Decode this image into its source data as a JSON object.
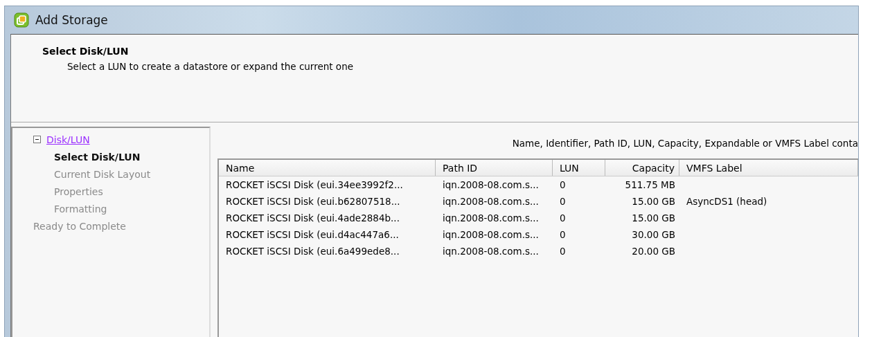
{
  "window": {
    "title": "Add Storage"
  },
  "header": {
    "title": "Select Disk/LUN",
    "subtitle": "Select a LUN to create a datastore or expand the current one"
  },
  "steps": [
    {
      "label": "Disk/LUN",
      "kind": "link",
      "selected": false,
      "expanded": true,
      "children": [
        {
          "label": "Select Disk/LUN",
          "selected": true
        },
        {
          "label": "Current Disk Layout",
          "selected": false
        },
        {
          "label": "Properties",
          "selected": false
        },
        {
          "label": "Formatting",
          "selected": false
        }
      ]
    },
    {
      "label": "Ready to Complete",
      "kind": "step",
      "selected": false
    }
  ],
  "filter_hint": "Name, Identifier, Path ID, LUN, Capacity, Expandable or VMFS Label conta",
  "table": {
    "columns": [
      "Name",
      "Path ID",
      "LUN",
      "Capacity",
      "VMFS Label"
    ],
    "rows": [
      [
        "ROCKET iSCSI Disk (eui.34ee3992f2...",
        "iqn.2008-08.com.s...",
        "0",
        "511.75 MB",
        ""
      ],
      [
        "ROCKET iSCSI Disk (eui.b62807518...",
        "iqn.2008-08.com.s...",
        "0",
        "15.00 GB",
        "AsyncDS1 (head)"
      ],
      [
        "ROCKET iSCSI Disk (eui.4ade2884b...",
        "iqn.2008-08.com.s...",
        "0",
        "15.00 GB",
        ""
      ],
      [
        "ROCKET iSCSI Disk (eui.d4ac447a6...",
        "iqn.2008-08.com.s...",
        "0",
        "30.00 GB",
        ""
      ],
      [
        "ROCKET iSCSI Disk (eui.6a499ede8...",
        "iqn.2008-08.com.s...",
        "0",
        "20.00 GB",
        ""
      ]
    ]
  }
}
